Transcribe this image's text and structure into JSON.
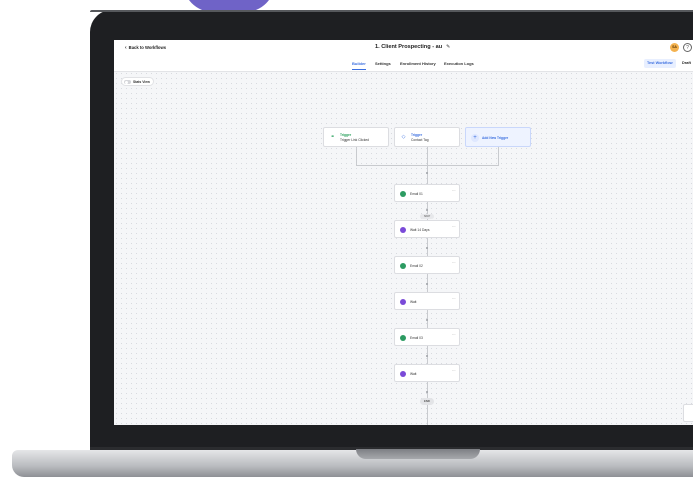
{
  "header": {
    "back_label": "Back to Workflows",
    "title": "1. Client Prospecting - au",
    "avatar_initials": "SA"
  },
  "tabs": [
    {
      "label": "Builder",
      "active": true
    },
    {
      "label": "Settings",
      "active": false
    },
    {
      "label": "Enrollment History",
      "active": false
    },
    {
      "label": "Execution Logs",
      "active": false
    }
  ],
  "actions": {
    "test_workflow": "Test Workflow",
    "draft": "Draft"
  },
  "stats_view": {
    "label": "Stats View",
    "enabled": false
  },
  "triggers": [
    {
      "title": "Trigger",
      "subtitle": "Trigger Link Clicked",
      "icon": "link-icon"
    },
    {
      "title": "Trigger",
      "subtitle": "Contact Tag",
      "icon": "tag-icon"
    }
  ],
  "add_trigger_label": "Add New Trigger",
  "steps": [
    {
      "type": "email",
      "label": "Email 01"
    },
    {
      "type": "wait",
      "label": "Wait 14 Days"
    },
    {
      "type": "email",
      "label": "Email 02"
    },
    {
      "type": "wait",
      "label": "Wait"
    },
    {
      "type": "email",
      "label": "Email 03"
    },
    {
      "type": "wait",
      "label": "Wait"
    }
  ],
  "branch_pill": "SKIP",
  "end_label": "END",
  "colors": {
    "accent": "#3b6fe0",
    "email_icon": "#2c9b62",
    "wait_icon": "#7a4ad8",
    "trigger_title": "#27a05b",
    "avatar": "#f4b24f",
    "decor_purple": "#6f63c7"
  }
}
